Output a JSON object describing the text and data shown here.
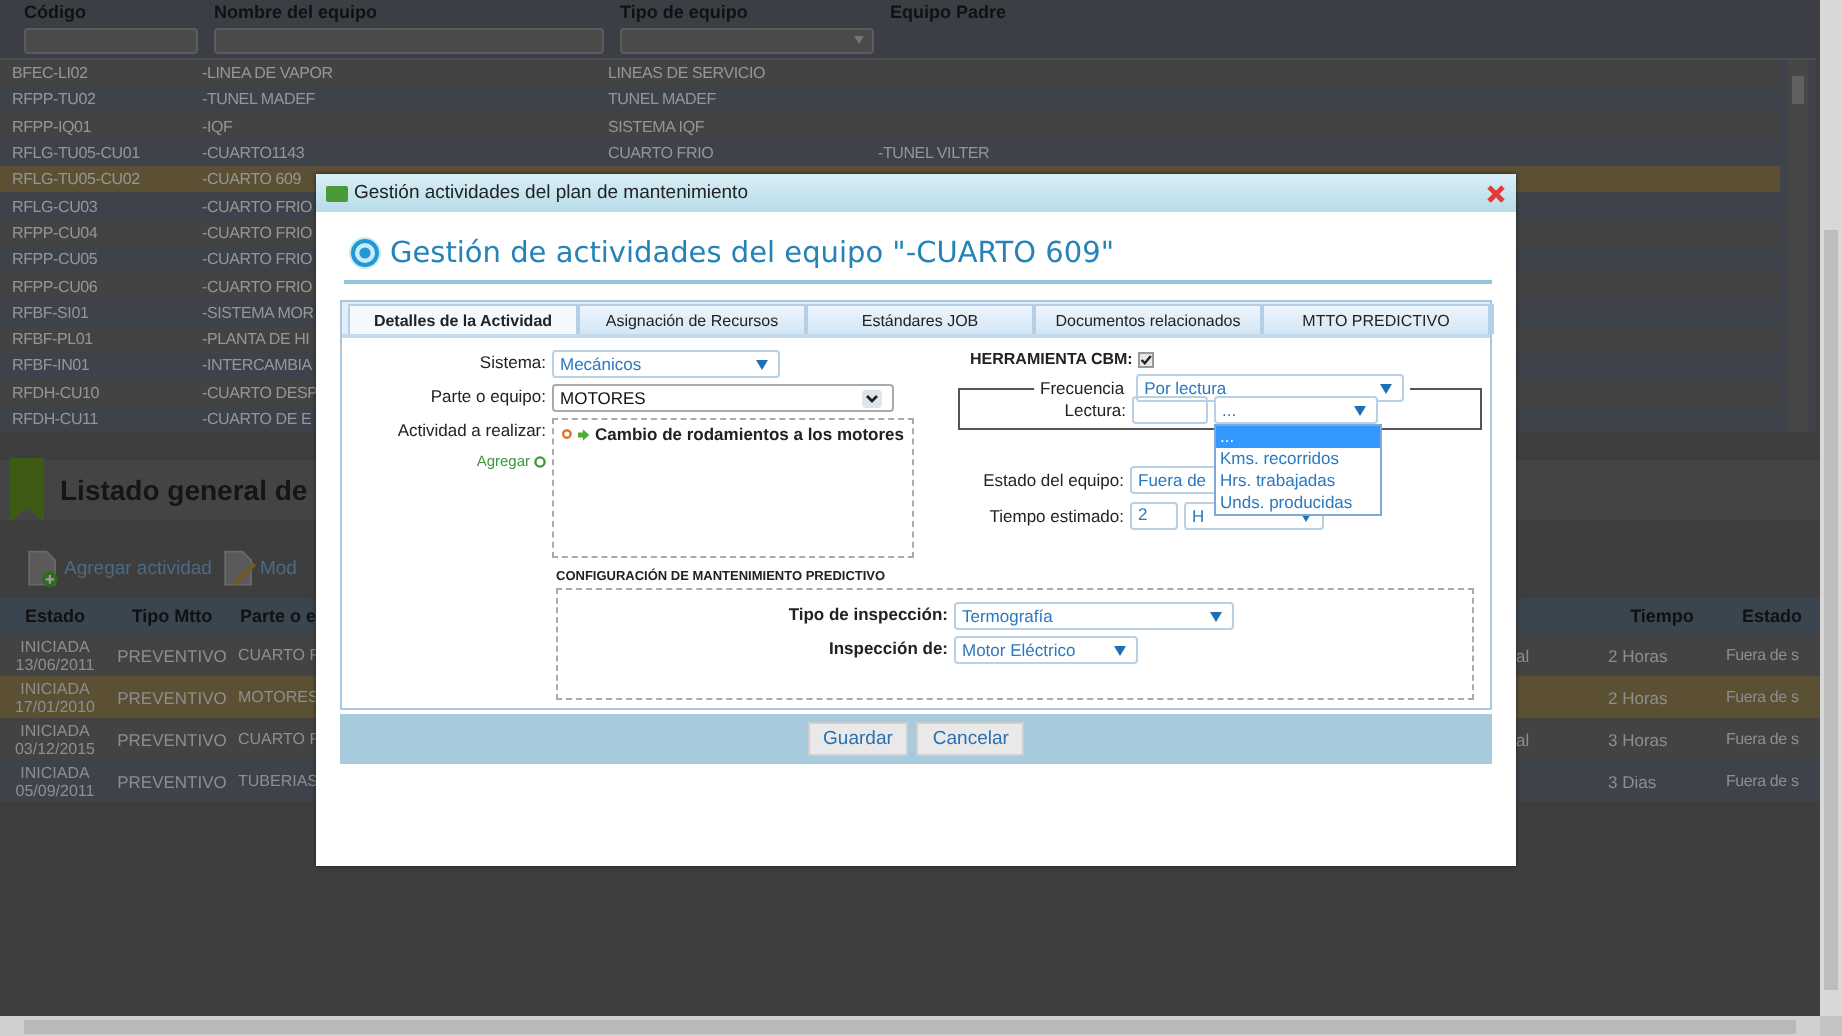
{
  "equipment_grid": {
    "columns": [
      "Código",
      "Nombre del equipo",
      "Tipo de equipo",
      "Equipo Padre"
    ],
    "rows": [
      {
        "cells": [
          "BFEC-LI02",
          "-LINEA DE VAPOR",
          "LINEAS DE SERVICIO",
          ""
        ],
        "selected": false
      },
      {
        "cells": [
          "RFPP-TU02",
          "-TUNEL MADEF",
          "TUNEL MADEF",
          ""
        ],
        "selected": false
      },
      {
        "cells": [
          "RFPP-IQ01",
          "-IQF",
          "SISTEMA IQF",
          ""
        ],
        "selected": false
      },
      {
        "cells": [
          "RFLG-TU05-CU01",
          "-CUARTO1143",
          "CUARTO FRIO",
          "-TUNEL VILTER"
        ],
        "selected": false
      },
      {
        "cells": [
          "RFLG-TU05-CU02",
          "-CUARTO 609",
          "",
          ""
        ],
        "selected": true
      },
      {
        "cells": [
          "RFLG-CU03",
          "-CUARTO FRIO",
          "",
          ""
        ],
        "selected": false
      },
      {
        "cells": [
          "RFPP-CU04",
          "-CUARTO FRIO",
          "",
          ""
        ],
        "selected": false
      },
      {
        "cells": [
          "RFPP-CU05",
          "-CUARTO FRIO",
          "",
          ""
        ],
        "selected": false
      },
      {
        "cells": [
          "RFPP-CU06",
          "-CUARTO FRIO",
          "",
          ""
        ],
        "selected": false
      },
      {
        "cells": [
          "RFBF-SI01",
          "-SISTEMA MOR",
          "",
          ""
        ],
        "selected": false
      },
      {
        "cells": [
          "RFBF-PL01",
          "-PLANTA DE HI",
          "",
          ""
        ],
        "selected": false
      },
      {
        "cells": [
          "RFBF-IN01",
          "-INTERCAMBIA",
          "",
          ""
        ],
        "selected": false
      },
      {
        "cells": [
          "RFDH-CU10",
          "-CUARTO DESP",
          "",
          ""
        ],
        "selected": false
      },
      {
        "cells": [
          "RFDH-CU11",
          "-CUARTO DE E",
          "",
          ""
        ],
        "selected": false
      }
    ]
  },
  "activities": {
    "title": "Listado general de",
    "toolbar": [
      {
        "kind": "add",
        "label": "Agregar actividad"
      },
      {
        "kind": "edit",
        "label": "Mod"
      }
    ],
    "columns": [
      "Estado",
      "Tipo Mtto",
      "Parte o e",
      "",
      "Tiempo",
      "Estado"
    ],
    "rows": [
      {
        "status": "INICIADA",
        "date": "13/06/2011",
        "type": "PREVENTIVO",
        "part": "CUARTO F",
        "column_4": "al",
        "time": "2 Horas",
        "state": "Fuera de s",
        "selected": false
      },
      {
        "status": "INICIADA",
        "date": "17/01/2010",
        "type": "PREVENTIVO",
        "part": "MOTORES",
        "column_4": "",
        "time": "2 Horas",
        "state": "Fuera de s",
        "selected": true
      },
      {
        "status": "INICIADA",
        "date": "03/12/2015",
        "type": "PREVENTIVO",
        "part": "CUARTO F",
        "column_4": "al",
        "time": "3 Horas",
        "state": "Fuera de s",
        "selected": false
      },
      {
        "status": "INICIADA",
        "date": "05/09/2011",
        "type": "PREVENTIVO",
        "part": "TUBERIAS",
        "column_4": "",
        "time": "3 Dias",
        "state": "Fuera de s",
        "selected": false
      }
    ]
  },
  "modal": {
    "title": "Gestión actividades del plan de mantenimiento",
    "heading": "Gestión de actividades del equipo \"-CUARTO 609\"",
    "tabs": [
      {
        "label": "Detalles de la Actividad",
        "selected": true
      },
      {
        "label": "Asignación de Recursos",
        "selected": false
      },
      {
        "label": "Estándares JOB",
        "selected": false
      },
      {
        "label": "Documentos relacionados",
        "selected": false
      },
      {
        "label": "MTTO PREDICTIVO",
        "selected": false
      }
    ],
    "system": {
      "label": "Sistema:",
      "value": "Mecánicos"
    },
    "part": {
      "label": "Parte o equipo:",
      "value": "MOTORES"
    },
    "activity": {
      "label": "Actividad a realizar:",
      "add_link": "Agregar",
      "items": [
        "Cambio de rodamientos a los motores"
      ]
    },
    "cbm": {
      "label": "HERRAMIENTA CBM:",
      "checked": true
    },
    "frequency": {
      "legend": "Frecuencia",
      "value": "Por lectura"
    },
    "reading": {
      "label": "Lectura:",
      "unit": "...",
      "expanded": true,
      "options": [
        {
          "label": "...",
          "selected": true
        },
        {
          "label": "Kms. recorridos",
          "selected": false
        },
        {
          "label": "Hrs. trabajadas",
          "selected": false
        },
        {
          "label": "Unds. producidas",
          "selected": false
        }
      ]
    },
    "equipment_state": {
      "label": "Estado del equipo:",
      "value": "Fuera de"
    },
    "estimated_time": {
      "label": "Tiempo estimado:",
      "value": "2",
      "unit": "H"
    },
    "predictive": {
      "title": "CONFIGURACIÓN DE MANTENIMIENTO PREDICTIVO",
      "inspection_type": {
        "label": "Tipo de inspección:",
        "value": "Termografía"
      },
      "inspection_of": {
        "label": "Inspección de:",
        "value": "Motor Eléctrico"
      }
    },
    "buttons": [
      "Guardar",
      "Cancelar"
    ]
  }
}
